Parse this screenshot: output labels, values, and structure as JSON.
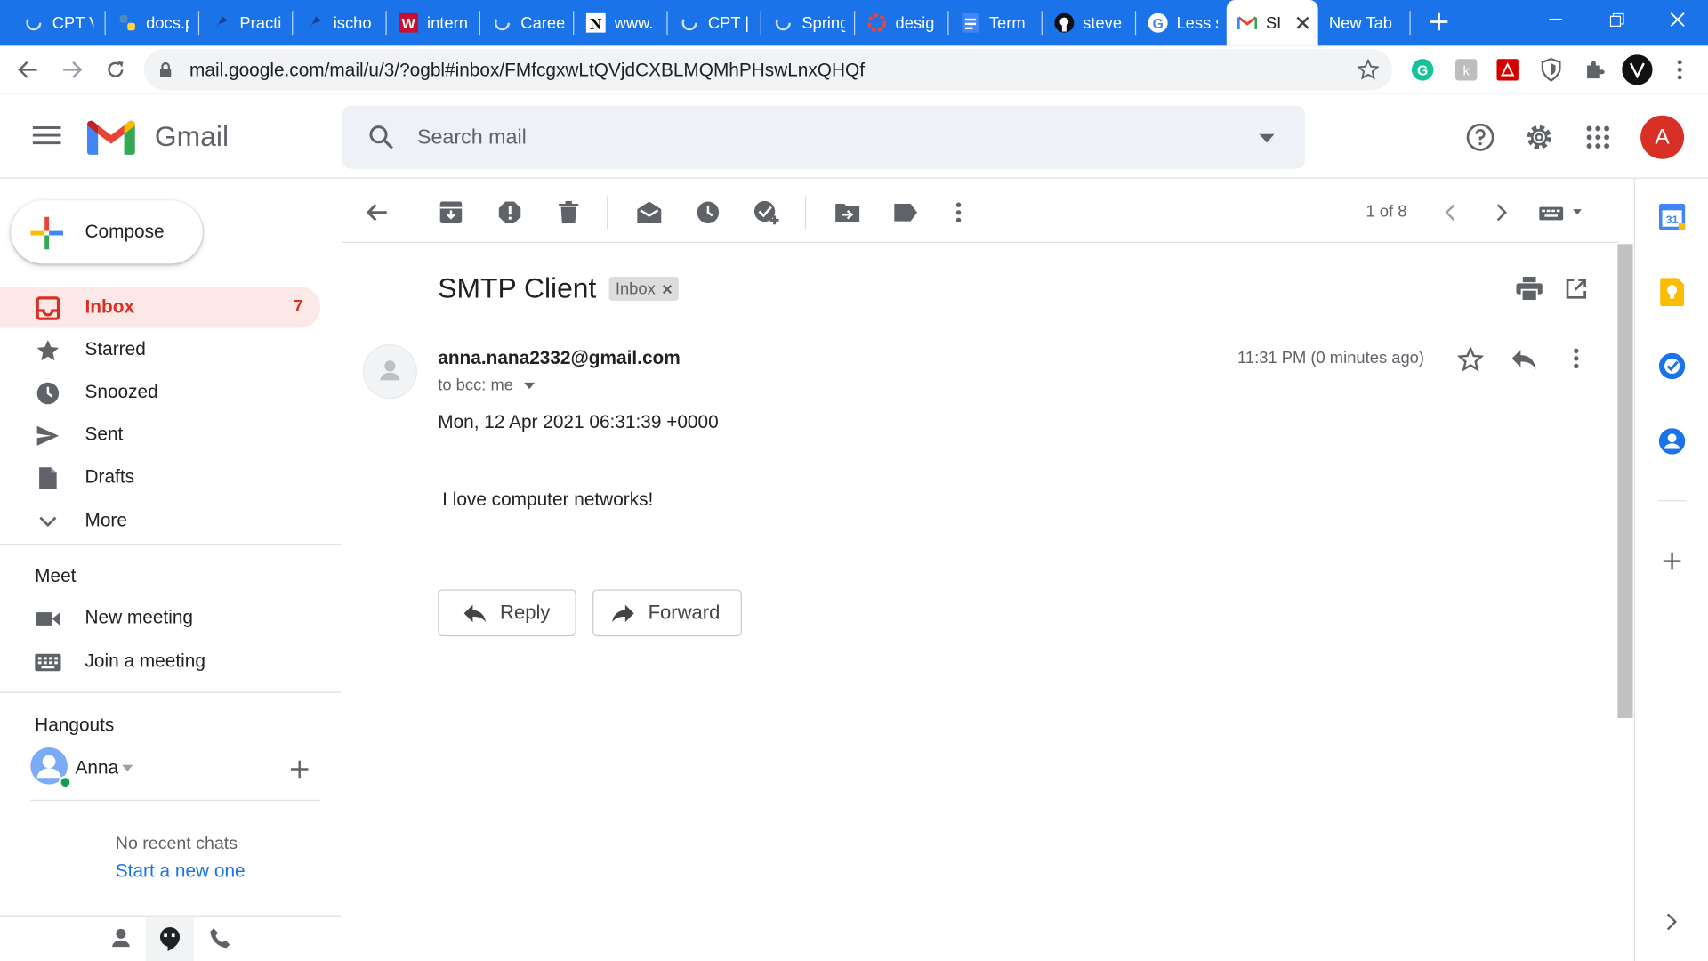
{
  "browser": {
    "tabs": [
      {
        "title": "CPT V",
        "icon": "loading-icon"
      },
      {
        "title": "docs.p",
        "icon": "python-icon"
      },
      {
        "title": "Practi",
        "icon": "p-icon"
      },
      {
        "title": "ischo",
        "icon": "p-icon"
      },
      {
        "title": "intern",
        "icon": "w-icon"
      },
      {
        "title": "Caree",
        "icon": "loading-icon"
      },
      {
        "title": "www.",
        "icon": "n-icon"
      },
      {
        "title": "CPT |",
        "icon": "loading-icon"
      },
      {
        "title": "Spring",
        "icon": "loading-icon"
      },
      {
        "title": "desig",
        "icon": "circle-icon"
      },
      {
        "title": "Term",
        "icon": "docs-icon"
      },
      {
        "title": "steve",
        "icon": "github-icon"
      },
      {
        "title": "Less s",
        "icon": "google-icon"
      },
      {
        "title": "SI",
        "icon": "gmail-icon"
      },
      {
        "title": "New Tab",
        "icon": ""
      }
    ],
    "url": "mail.google.com/mail/u/3/?ogbl#inbox/FMfcgxwLtQVjdCXBLMQMhPHswLnxQHQf"
  },
  "gmail": {
    "brand": "Gmail",
    "search_placeholder": "Search mail",
    "avatar_letter": "A",
    "compose_label": "Compose",
    "nav": [
      {
        "label": "Inbox",
        "count": "7"
      },
      {
        "label": "Starred"
      },
      {
        "label": "Snoozed"
      },
      {
        "label": "Sent"
      },
      {
        "label": "Drafts"
      },
      {
        "label": "More"
      }
    ],
    "meet": {
      "title": "Meet",
      "new_meeting": "New meeting",
      "join_meeting": "Join a meeting"
    },
    "hangouts": {
      "title": "Hangouts",
      "user": "Anna",
      "no_chats": "No recent chats",
      "start_new": "Start a new one"
    },
    "pager": "1 of 8",
    "message": {
      "subject": "SMTP Client",
      "label": "Inbox",
      "sender": "anna.nana2332@gmail.com",
      "to": "to bcc: me",
      "time": "11:31 PM (0 minutes ago)",
      "date_line": "Mon, 12 Apr 2021 06:31:39 +0000",
      "body": "I love computer networks!"
    },
    "buttons": {
      "reply": "Reply",
      "forward": "Forward"
    },
    "colors": {
      "accent_blue": "#1a73e8",
      "inbox_red": "#d93025",
      "inbox_bg": "#fce8e6"
    }
  }
}
